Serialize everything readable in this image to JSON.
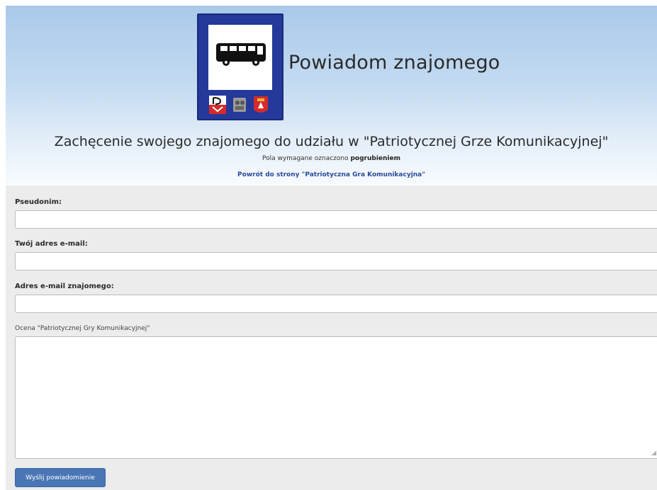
{
  "header": {
    "title": "Powiadom znajomego",
    "subtitle": "Zachęcenie swojego znajomego do udziału w \"Patriotycznej Grze Komunikacyjnej\"",
    "required_note_prefix": "Pola wymagane oznaczono ",
    "required_note_bold": "pogrubieniem",
    "back_link": "Powrót do strony \"Patriotyczna Gra Komunikacyjna\"",
    "sign_colors": {
      "frame": "#24399a",
      "panel": "#ffffff",
      "bus": "#111111"
    }
  },
  "form": {
    "nickname": {
      "label": "Pseudonim:",
      "value": ""
    },
    "your_email": {
      "label": "Twój adres e-mail:",
      "value": ""
    },
    "friend_email": {
      "label": "Adres e-mail znajomego:",
      "value": ""
    },
    "rating": {
      "label": "Ocena \"Patriotycznej Gry Komunikacyjnej\"",
      "value": ""
    },
    "submit_label": "Wyślij powiadomienie"
  },
  "colors": {
    "header_gradient_top": "#a9c9ea",
    "form_background": "#ececec",
    "button_background": "#4a76b6",
    "link_color": "#2a4a9a"
  }
}
